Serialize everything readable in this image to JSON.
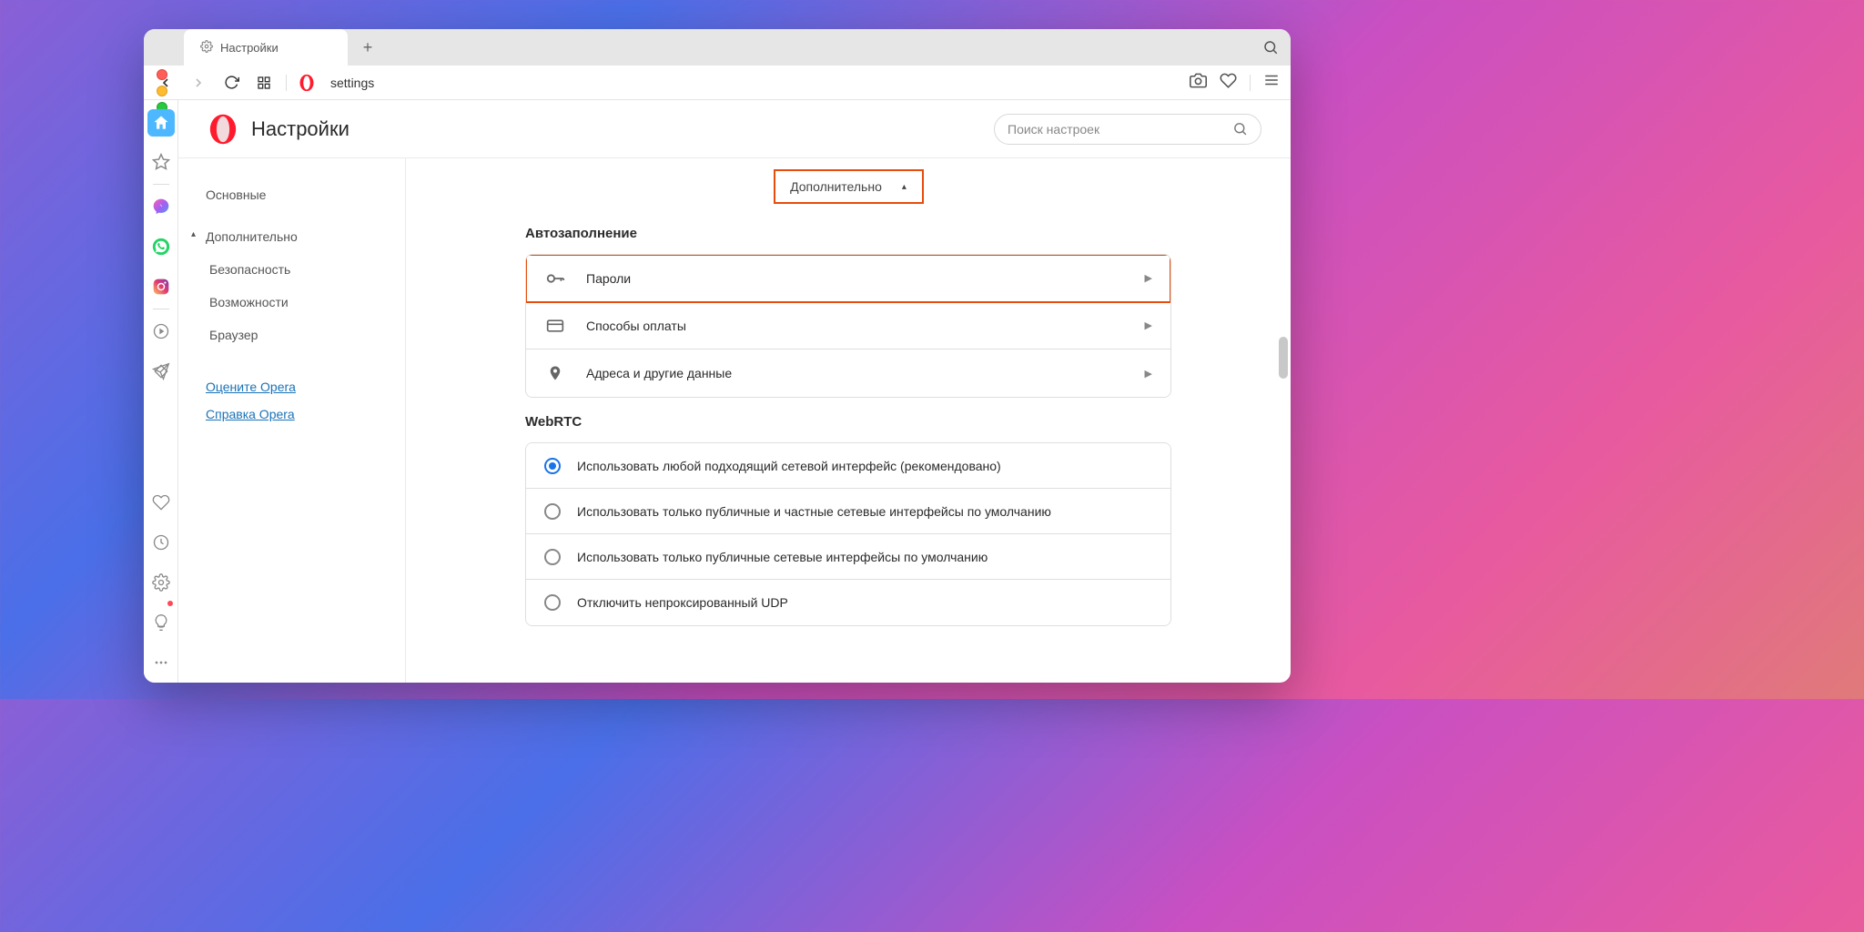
{
  "tab": {
    "title": "Настройки"
  },
  "url": "settings",
  "header": {
    "title": "Настройки"
  },
  "search": {
    "placeholder": "Поиск настроек"
  },
  "nav": {
    "basic": "Основные",
    "advanced": "Дополнительно",
    "security": "Безопасность",
    "features": "Возможности",
    "browser": "Браузер",
    "rate": "Оцените Opera",
    "help": "Справка Opera"
  },
  "dropdown": {
    "label": "Дополнительно"
  },
  "sections": {
    "autofill": {
      "title": "Автозаполнение",
      "rows": {
        "passwords": "Пароли",
        "payment": "Способы оплаты",
        "addresses": "Адреса и другие данные"
      }
    },
    "webrtc": {
      "title": "WebRTC",
      "options": {
        "r1": "Использовать любой подходящий сетевой интерфейс (рекомендовано)",
        "r2": "Использовать только публичные и частные сетевые интерфейсы по умолчанию",
        "r3": "Использовать только публичные сетевые интерфейсы по умолчанию",
        "r4": "Отключить непроксированный UDP"
      }
    }
  }
}
